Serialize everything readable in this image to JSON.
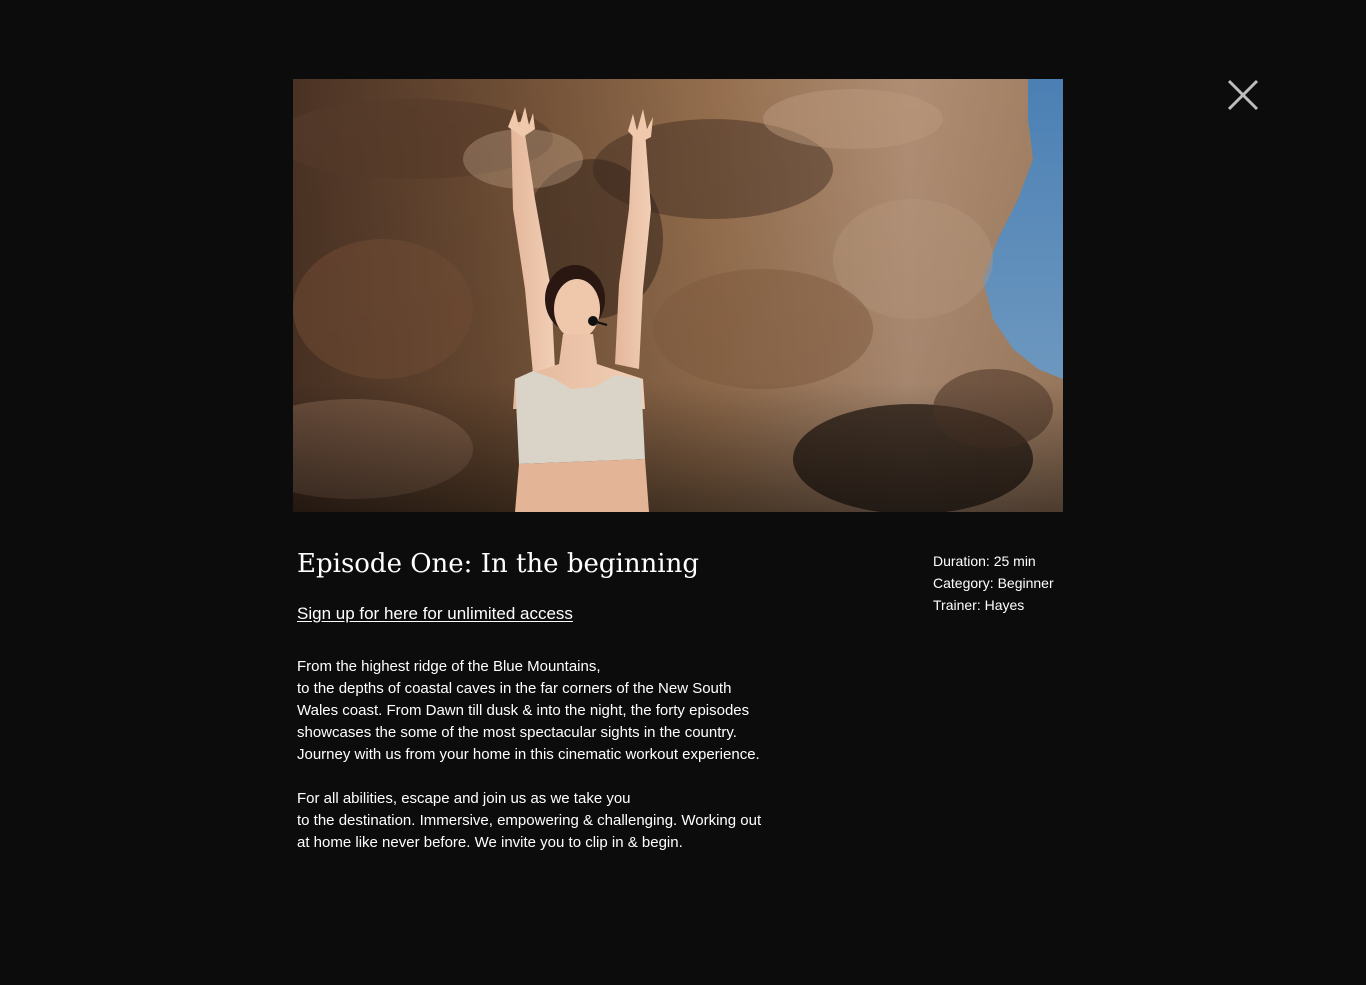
{
  "modal": {
    "close_icon": "close-icon",
    "hero_image": "woman-arms-raised-in-sandstone-cave-photo"
  },
  "episode": {
    "title": "Episode One: In the beginning",
    "signup_link": "Sign up for here for unlimited access",
    "paragraphs": [
      "From the highest ridge of the Blue Mountains,\nto the depths of coastal caves in the far corners of the New South Wales coast. From Dawn till dusk & into the night, the forty episodes showcases the some of the most spectacular sights in the country. Journey with us from your home in this cinematic workout experience.",
      "For all abilities, escape and join us as we take you\nto the destination. Immersive, empowering & challenging. Working out at home like never before. We invite you to clip in & begin."
    ]
  },
  "meta": {
    "duration": "Duration: 25 min",
    "category": "Category: Beginner",
    "trainer": "Trainer: Hayes"
  },
  "colors": {
    "background": "#0c0c0c",
    "text": "#ffffff",
    "close_icon": "#bdbdbd",
    "sky": "#5e8fc0",
    "rock": "#a57f5e"
  }
}
